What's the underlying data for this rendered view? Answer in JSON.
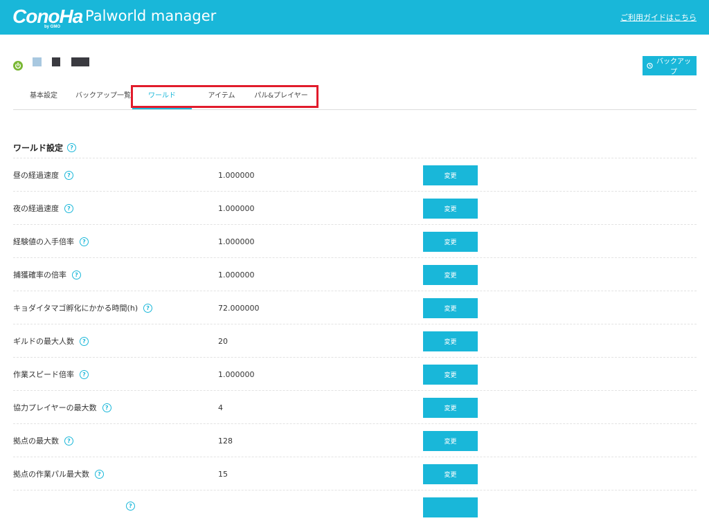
{
  "header": {
    "logo_text": "ConoHa",
    "logo_sub": "by GMO",
    "app_title": "Palworld manager",
    "guide_link": "ご利用ガイドはこちら"
  },
  "status": {
    "power_color": "#7ab834",
    "blocks": [
      "#a8c8e0",
      "#3a3a40",
      "#3a3a40"
    ]
  },
  "backup_button": "バックアップ",
  "tabs": [
    {
      "label": "基本設定",
      "active": false
    },
    {
      "label": "バックアップ一覧",
      "active": false
    },
    {
      "label": "ワールド",
      "active": true
    },
    {
      "label": "アイテム",
      "active": false
    },
    {
      "label": "パル&プレイヤー",
      "active": false
    }
  ],
  "section": {
    "title": "ワールド設定",
    "help_icon": "?"
  },
  "settings": [
    {
      "label": "昼の経過速度",
      "value": "1.000000",
      "button": "変更"
    },
    {
      "label": "夜の経過速度",
      "value": "1.000000",
      "button": "変更"
    },
    {
      "label": "経験値の入手倍率",
      "value": "1.000000",
      "button": "変更"
    },
    {
      "label": "捕獲確率の倍率",
      "value": "1.000000",
      "button": "変更"
    },
    {
      "label": "キョダイタマゴ孵化にかかる時間(h)",
      "value": "72.000000",
      "button": "変更"
    },
    {
      "label": "ギルドの最大人数",
      "value": "20",
      "button": "変更"
    },
    {
      "label": "作業スピード倍率",
      "value": "1.000000",
      "button": "変更"
    },
    {
      "label": "協力プレイヤーの最大数",
      "value": "4",
      "button": "変更"
    },
    {
      "label": "拠点の最大数",
      "value": "128",
      "button": "変更"
    },
    {
      "label": "拠点の作業パル最大数",
      "value": "15",
      "button": "変更"
    },
    {
      "label": "",
      "value": "",
      "button": ""
    }
  ],
  "colors": {
    "accent": "#19b7d9",
    "highlight": "#e11b2b"
  }
}
